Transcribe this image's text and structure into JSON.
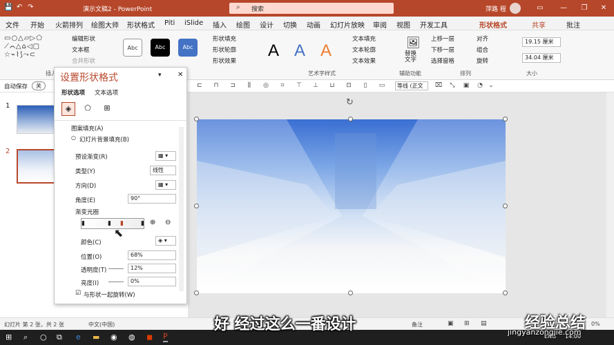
{
  "title_bar": {
    "title": "演示文稿2 - PowerPoint",
    "search": "搜索",
    "user": "萍路 程"
  },
  "menu": [
    "文件",
    "开始",
    "火箭排列",
    "绘图大师",
    "形状格式",
    "Piti",
    "iSlide",
    "插入",
    "绘图",
    "设计",
    "切换",
    "动画",
    "幻灯片放映",
    "审阅",
    "视图",
    "开发工具",
    "形状格式",
    "共享",
    "批注"
  ],
  "active_menu_index": 16,
  "ribbon": {
    "shape_cmds": [
      "编辑形状",
      "文本框",
      "合并形状"
    ],
    "style_swatches": [
      "Abc",
      "Abc",
      "Abc"
    ],
    "fill_cmds": [
      "形状填充",
      "形状轮廓",
      "形状效果"
    ],
    "wordart_A": "A",
    "text_cmds": [
      "文本填充",
      "文本轮廓",
      "文本效果"
    ],
    "alt_text": "替换文字",
    "arrange": [
      "上移一层",
      "下移一层",
      "选择窗格"
    ],
    "align": [
      "对齐",
      "组合",
      "旋转"
    ],
    "height": "19.15 厘米",
    "width": "34.04 厘米",
    "groups": [
      "插入",
      "艺术字样式",
      "辅助功能",
      "排列",
      "大小"
    ]
  },
  "autosave": {
    "label": "自动保存",
    "state": "关"
  },
  "toolbar2_select": "等线 (正文",
  "pane": {
    "title": "设置形状格式",
    "tabs": [
      "形状选项",
      "文本选项"
    ],
    "options": [
      "图案填充(A)",
      "幻灯片背景填充(B)"
    ],
    "preset_label": "预设渐变(R)",
    "type_label": "类型(Y)",
    "type_value": "线性",
    "direction_label": "方向(D)",
    "angle_label": "角度(E)",
    "angle_value": "90°",
    "stops_label": "渐变光圈",
    "color_label": "颜色(C)",
    "position_label": "位置(O)",
    "position_value": "68%",
    "transparency_label": "透明度(T)",
    "transparency_value": "12%",
    "brightness_label": "亮度(I)",
    "brightness_value": "0%",
    "rotate_label": "与形状一起旋转(W)"
  },
  "thumbnails": [
    "1",
    "2"
  ],
  "status": {
    "slide": "幻灯片 第 2 张，共 2 张",
    "lang": "中文(中国)",
    "notes": "备注",
    "zoom": "0%"
  },
  "subtitle": "好 经过这么一番设计",
  "watermark": "经验总结",
  "watermark_url": "jingyanzongjie.com",
  "taskbar": {
    "lang": "ENG",
    "time": "14:00"
  }
}
